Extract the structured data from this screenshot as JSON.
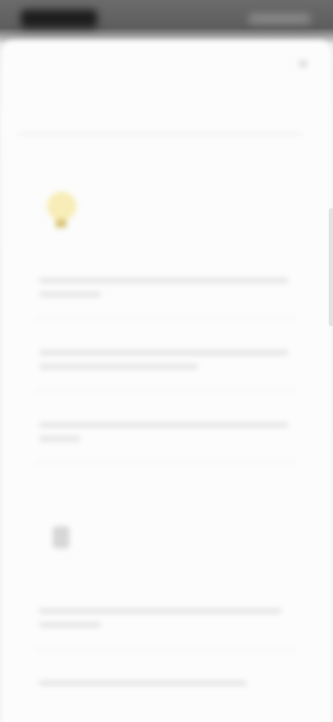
{
  "status_bar": {
    "left_label": "",
    "right_label": ""
  },
  "sheet": {
    "close_label": "✕",
    "tabs": [
      {
        "label": "",
        "active": true
      },
      {
        "label": "",
        "active": false
      }
    ]
  },
  "sections": [
    {
      "icon": "lightbulb-icon",
      "title": "",
      "subtitle": "",
      "items": [
        {
          "title": ""
        },
        {
          "title": ""
        },
        {
          "title": ""
        }
      ]
    },
    {
      "icon": "document-icon",
      "title": "",
      "subtitle": "",
      "items": [
        {
          "title": ""
        },
        {
          "title": ""
        }
      ]
    }
  ],
  "colors": {
    "accent_icon": "#f4d24a",
    "background": "#fbfcfb",
    "status_bar": "#5e5e5e"
  }
}
